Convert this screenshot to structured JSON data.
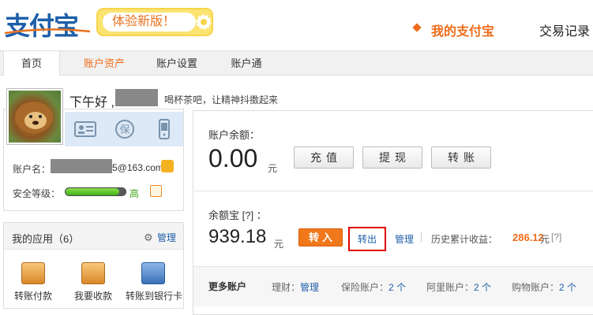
{
  "header": {
    "logo_text": "支付宝",
    "trial_badge": "体验新版！",
    "nav_my_alipay": "我的支付宝",
    "nav_trade_records": "交易记录"
  },
  "tabs": [
    {
      "label": "首页"
    },
    {
      "label": "账户资产"
    },
    {
      "label": "账户设置"
    },
    {
      "label": "账户通"
    }
  ],
  "greeting": {
    "text": "下午好 ,",
    "tip": "喝杯茶吧，让精神抖擞起来"
  },
  "profile": {
    "account_label": "账户名：",
    "account_email_suffix": "5@163.com",
    "security_label": "安全等级：",
    "security_level": "高",
    "security_level_fraction": 0.9
  },
  "apps": {
    "title": "我的应用（6）",
    "manage": "管理",
    "items": [
      {
        "label": "转账付款",
        "icon": "transfer-pay-icon"
      },
      {
        "label": "我要收款",
        "icon": "receive-money-icon"
      },
      {
        "label": "转账到银行卡",
        "icon": "transfer-to-bank-card-icon"
      }
    ]
  },
  "balance": {
    "label": "账户余额：",
    "amount": "0.00",
    "unit": "元",
    "buttons": [
      "充值",
      "提现",
      "转账"
    ]
  },
  "yuebao": {
    "label": "余额宝 [?] ：",
    "amount": "939.18",
    "unit": "元",
    "transfer_in": "转入",
    "transfer_out": "转出",
    "manage": "管理",
    "history_label": "历史累计收益：",
    "history_value": "286.12",
    "history_unit": "元",
    "help": "[?]"
  },
  "more_accounts": {
    "title": "更多账户",
    "items": [
      {
        "label": "理财：",
        "value": "管理"
      },
      {
        "label": "保险账户：",
        "value": "2 个"
      },
      {
        "label": "阿里账户：",
        "value": "2 个"
      },
      {
        "label": "购物账户：",
        "value": "2 个"
      }
    ]
  },
  "colors": {
    "brand_orange": "#ef6c1a",
    "link_blue": "#1f5fa6",
    "highlight_red": "#e00000"
  }
}
